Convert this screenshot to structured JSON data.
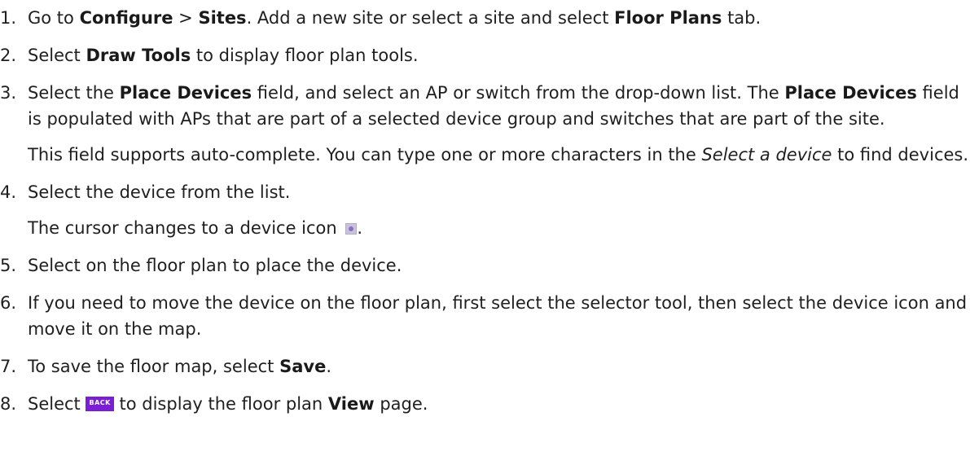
{
  "steps": [
    {
      "num": "1.",
      "t1": "Go to ",
      "b1": "Configure",
      "t2": " > ",
      "b2": "Sites",
      "t3": ". Add a new site or select a site and select ",
      "b3": "Floor Plans",
      "t4": " tab."
    },
    {
      "num": "2.",
      "t1": "Select ",
      "b1": "Draw Tools",
      "t2": " to display floor plan tools."
    },
    {
      "num": "3.",
      "t1": "Select the ",
      "b1": "Place Devices",
      "t2": " field, and select an AP or switch from the drop-down list. The ",
      "b2": "Place Devices",
      "t3": " field is populated with APs that are part of a selected device group and switches that are part of the site.",
      "sub_t1": "This field supports auto-complete. You can type one or more characters in the ",
      "sub_i1": "Select a device",
      "sub_t2": " to find devices."
    },
    {
      "num": "4.",
      "t1": "Select the device from the list.",
      "sub_t1": "The cursor changes to a device icon ",
      "sub_t2": ".",
      "icon": "device-icon"
    },
    {
      "num": "5.",
      "t1": "Select on the floor plan to place the device."
    },
    {
      "num": "6.",
      "t1": "If you need to move the device on the floor plan, first select the selector tool, then select the device icon and move it on the map."
    },
    {
      "num": "7.",
      "t1": "To save the floor map, select ",
      "b1": "Save",
      "t2": "."
    },
    {
      "num": "8.",
      "t1": "Select ",
      "back_label": "BACK",
      "t2": " to display the floor plan ",
      "b1": "View",
      "t3": " page."
    }
  ],
  "colors": {
    "text": "#1f1f1f",
    "back_button": "#7a1fd6",
    "device_icon": "#8e6ac9"
  }
}
